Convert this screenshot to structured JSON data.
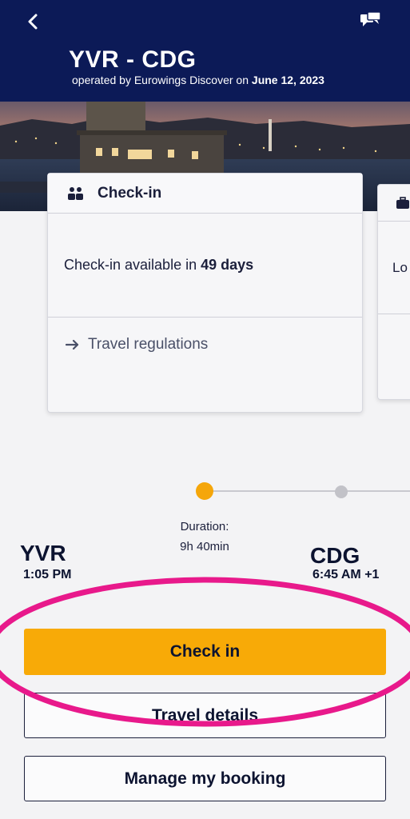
{
  "header": {
    "route": "YVR - CDG",
    "operated_prefix": "operated by Eurowings Discover on",
    "date": "June 12, 2023"
  },
  "checkin_card": {
    "title": "Check-in",
    "available_prefix": "Check-in available in",
    "available_days": "49 days",
    "link_label": "Travel regulations"
  },
  "side_card": {
    "partial_text": "Lo"
  },
  "flight": {
    "origin_code": "YVR",
    "origin_time": "1:05 PM",
    "destination_code": "CDG",
    "destination_time": "6:45 AM +1",
    "duration_label": "Duration:",
    "duration_value": "9h 40min"
  },
  "buttons": {
    "check_in": "Check in",
    "travel_details": "Travel details",
    "manage_booking": "Manage my booking"
  },
  "colors": {
    "header_bg": "#0c1a57",
    "accent": "#f8aa07",
    "highlight": "#e8198b"
  },
  "icons": {
    "back": "chevron-left-icon",
    "chat": "chat-bubbles-icon",
    "checkin": "passengers-icon",
    "luggage": "suitcase-icon",
    "link": "arrow-right-icon"
  }
}
